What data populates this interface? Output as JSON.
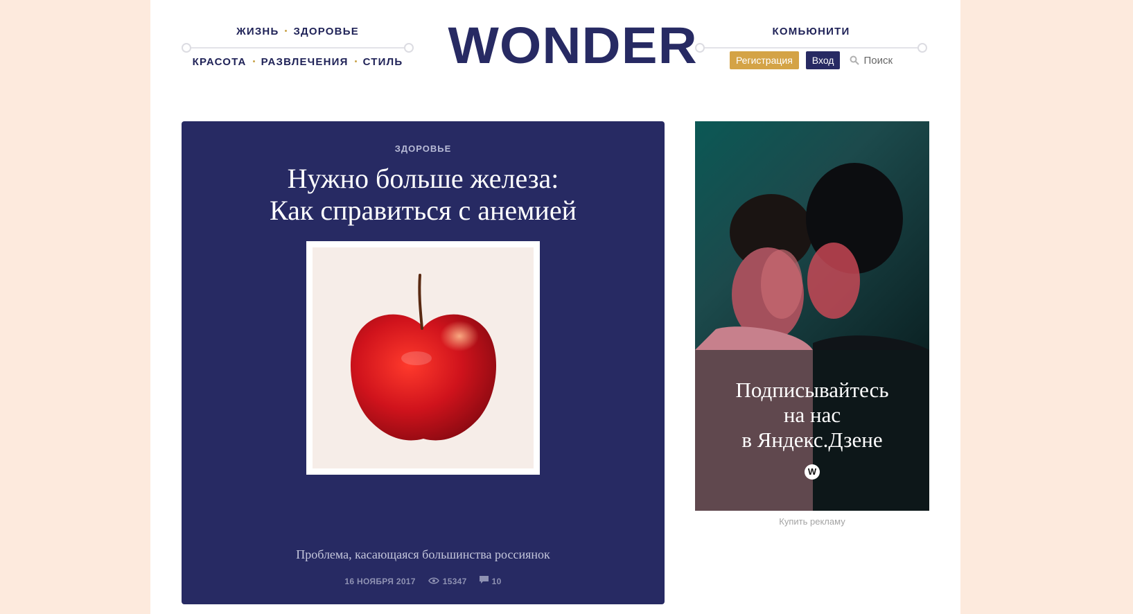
{
  "nav_left": {
    "top": [
      "ЖИЗНЬ",
      "ЗДОРОВЬЕ"
    ],
    "bottom": [
      "КРАСОТА",
      "РАЗВЛЕЧЕНИЯ",
      "СТИЛЬ"
    ]
  },
  "logo": "WONDER",
  "nav_right": {
    "community": "КОМЬЮНИТИ",
    "register": "Регистрация",
    "login": "Вход",
    "search_placeholder": "Поиск"
  },
  "feature": {
    "category": "ЗДОРОВЬЕ",
    "title_line1": "Нужно больше железа:",
    "title_line2": "Как справиться с анемией",
    "subtitle": "Проблема, касающаяся большинства россиянок",
    "date": "16 НОЯБРЯ 2017",
    "views": "15347",
    "comments": "10"
  },
  "ad": {
    "line1": "Подписывайтесь",
    "line2": "на нас",
    "line3": "в Яндекс.Дзене",
    "logo_letter": "W",
    "buy_ad": "Купить рекламу"
  },
  "colors": {
    "brand": "#272a63",
    "accent": "#d4a346",
    "page_bg": "#fdeadd"
  }
}
